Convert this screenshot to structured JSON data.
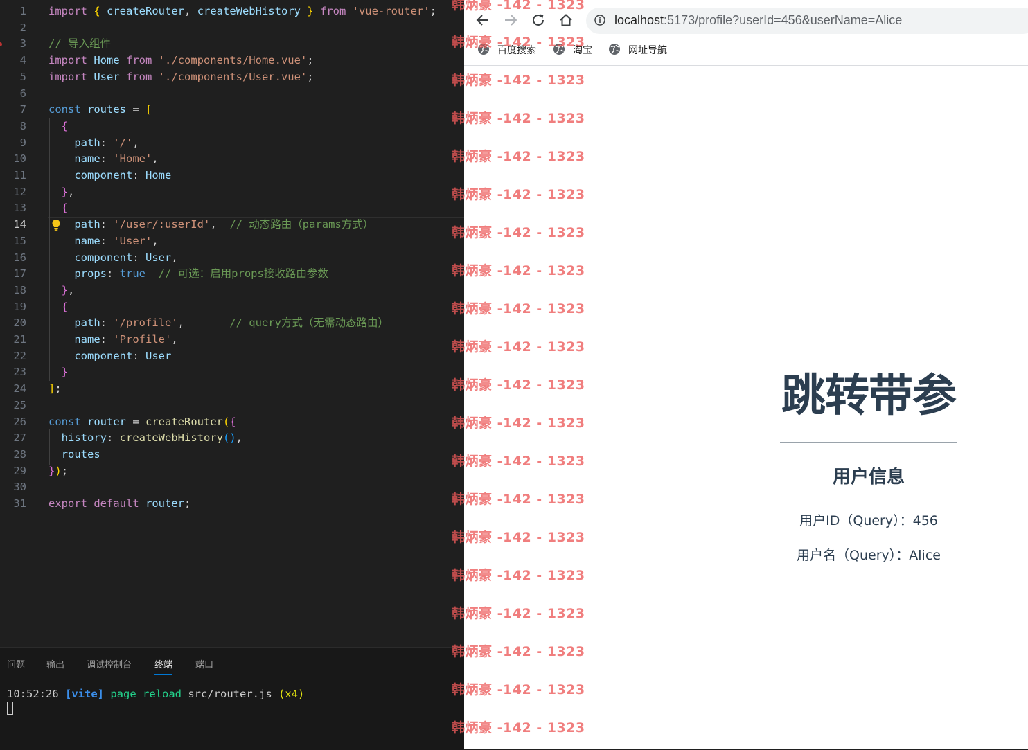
{
  "editor": {
    "lines": [
      {
        "n": "1",
        "tokens": [
          [
            "kw2",
            "import "
          ],
          [
            "br1",
            "{ "
          ],
          [
            "id",
            "createRouter"
          ],
          [
            "pu",
            ", "
          ],
          [
            "id",
            "createWebHistory"
          ],
          [
            "br1",
            " }"
          ],
          [
            "kw2",
            " from "
          ],
          [
            "str",
            "'vue-router'"
          ],
          [
            "pu",
            ";"
          ]
        ]
      },
      {
        "n": "2",
        "tokens": []
      },
      {
        "n": "3",
        "tokens": [
          [
            "cm",
            "// 导入组件"
          ]
        ]
      },
      {
        "n": "4",
        "tokens": [
          [
            "kw2",
            "import "
          ],
          [
            "id",
            "Home"
          ],
          [
            "kw2",
            " from "
          ],
          [
            "str",
            "'./components/Home.vue'"
          ],
          [
            "pu",
            ";"
          ]
        ]
      },
      {
        "n": "5",
        "tokens": [
          [
            "kw2",
            "import "
          ],
          [
            "id",
            "User"
          ],
          [
            "kw2",
            " from "
          ],
          [
            "str",
            "'./components/User.vue'"
          ],
          [
            "pu",
            ";"
          ]
        ]
      },
      {
        "n": "6",
        "tokens": []
      },
      {
        "n": "7",
        "tokens": [
          [
            "kw",
            "const "
          ],
          [
            "id",
            "routes"
          ],
          [
            "pu",
            " = "
          ],
          [
            "br1",
            "["
          ]
        ]
      },
      {
        "n": "8",
        "tokens": [
          [
            "pu",
            "  "
          ],
          [
            "br2",
            "{"
          ]
        ]
      },
      {
        "n": "9",
        "tokens": [
          [
            "pu",
            "    "
          ],
          [
            "id",
            "path"
          ],
          [
            "pu",
            ": "
          ],
          [
            "str",
            "'/'"
          ],
          [
            "pu",
            ","
          ]
        ]
      },
      {
        "n": "10",
        "tokens": [
          [
            "pu",
            "    "
          ],
          [
            "id",
            "name"
          ],
          [
            "pu",
            ": "
          ],
          [
            "str",
            "'Home'"
          ],
          [
            "pu",
            ","
          ]
        ]
      },
      {
        "n": "11",
        "tokens": [
          [
            "pu",
            "    "
          ],
          [
            "id",
            "component"
          ],
          [
            "pu",
            ": "
          ],
          [
            "id",
            "Home"
          ]
        ]
      },
      {
        "n": "12",
        "tokens": [
          [
            "pu",
            "  "
          ],
          [
            "br2",
            "}"
          ],
          [
            "pu",
            ","
          ]
        ]
      },
      {
        "n": "13",
        "tokens": [
          [
            "pu",
            "  "
          ],
          [
            "br2",
            "{"
          ]
        ]
      },
      {
        "n": "14",
        "tokens": [
          [
            "pu",
            "    "
          ],
          [
            "id",
            "path"
          ],
          [
            "pu",
            ": "
          ],
          [
            "str",
            "'/user/:userId'"
          ],
          [
            "pu",
            ",  "
          ],
          [
            "cm",
            "// 动态路由（params方式）"
          ]
        ]
      },
      {
        "n": "15",
        "tokens": [
          [
            "pu",
            "    "
          ],
          [
            "id",
            "name"
          ],
          [
            "pu",
            ": "
          ],
          [
            "str",
            "'User'"
          ],
          [
            "pu",
            ","
          ]
        ]
      },
      {
        "n": "16",
        "tokens": [
          [
            "pu",
            "    "
          ],
          [
            "id",
            "component"
          ],
          [
            "pu",
            ": "
          ],
          [
            "id",
            "User"
          ],
          [
            "pu",
            ","
          ]
        ]
      },
      {
        "n": "17",
        "tokens": [
          [
            "pu",
            "    "
          ],
          [
            "id",
            "props"
          ],
          [
            "pu",
            ": "
          ],
          [
            "kw",
            "true"
          ],
          [
            "pu",
            "  "
          ],
          [
            "cm",
            "// 可选：启用props接收路由参数"
          ]
        ]
      },
      {
        "n": "18",
        "tokens": [
          [
            "pu",
            "  "
          ],
          [
            "br2",
            "}"
          ],
          [
            "pu",
            ","
          ]
        ]
      },
      {
        "n": "19",
        "tokens": [
          [
            "pu",
            "  "
          ],
          [
            "br2",
            "{"
          ]
        ]
      },
      {
        "n": "20",
        "tokens": [
          [
            "pu",
            "    "
          ],
          [
            "id",
            "path"
          ],
          [
            "pu",
            ": "
          ],
          [
            "str",
            "'/profile'"
          ],
          [
            "pu",
            ",       "
          ],
          [
            "cm",
            "// query方式（无需动态路由）"
          ]
        ]
      },
      {
        "n": "21",
        "tokens": [
          [
            "pu",
            "    "
          ],
          [
            "id",
            "name"
          ],
          [
            "pu",
            ": "
          ],
          [
            "str",
            "'Profile'"
          ],
          [
            "pu",
            ","
          ]
        ]
      },
      {
        "n": "22",
        "tokens": [
          [
            "pu",
            "    "
          ],
          [
            "id",
            "component"
          ],
          [
            "pu",
            ": "
          ],
          [
            "id",
            "User"
          ]
        ]
      },
      {
        "n": "23",
        "tokens": [
          [
            "pu",
            "  "
          ],
          [
            "br2",
            "}"
          ]
        ]
      },
      {
        "n": "24",
        "tokens": [
          [
            "br1",
            "]"
          ],
          [
            "pu",
            ";"
          ]
        ]
      },
      {
        "n": "25",
        "tokens": []
      },
      {
        "n": "26",
        "tokens": [
          [
            "kw",
            "const "
          ],
          [
            "id",
            "router"
          ],
          [
            "pu",
            " = "
          ],
          [
            "fn",
            "createRouter"
          ],
          [
            "br1",
            "("
          ],
          [
            "br2",
            "{"
          ]
        ]
      },
      {
        "n": "27",
        "tokens": [
          [
            "pu",
            "  "
          ],
          [
            "id",
            "history"
          ],
          [
            "pu",
            ": "
          ],
          [
            "fn",
            "createWebHistory"
          ],
          [
            "br3",
            "()"
          ],
          [
            "pu",
            ","
          ]
        ]
      },
      {
        "n": "28",
        "tokens": [
          [
            "pu",
            "  "
          ],
          [
            "id",
            "routes"
          ]
        ]
      },
      {
        "n": "29",
        "tokens": [
          [
            "br2",
            "}"
          ],
          [
            "br1",
            ")"
          ],
          [
            "pu",
            ";"
          ]
        ]
      },
      {
        "n": "30",
        "tokens": []
      },
      {
        "n": "31",
        "tokens": [
          [
            "kw2",
            "export "
          ],
          [
            "kw2",
            "default "
          ],
          [
            "id",
            "router"
          ],
          [
            "pu",
            ";"
          ]
        ]
      }
    ]
  },
  "panel": {
    "tabs": [
      "问题",
      "输出",
      "调试控制台",
      "终端",
      "端口"
    ],
    "active_tab": "终端",
    "terminal": {
      "time": "10:52:26",
      "tag": "[vite]",
      "action": "page reload",
      "file": "src/router.js",
      "count": "(x4)"
    }
  },
  "browser": {
    "url_host": "localhost",
    "url_rest": ":5173/profile?userId=456&userName=Alice",
    "bookmarks": [
      "百度搜索",
      "淘宝",
      "网址导航"
    ],
    "page": {
      "title": "跳转带参",
      "subtitle": "用户信息",
      "user_id_line": "用户ID（Query）：456",
      "user_name_line": "用户名（Query）：Alice"
    }
  },
  "watermark": {
    "text": "韩炳豪 -142 - 1323"
  },
  "colors": {
    "editor_bg": "#1f1f1f",
    "page_text": "#2c3e50",
    "watermark": "#ec5a5a"
  }
}
